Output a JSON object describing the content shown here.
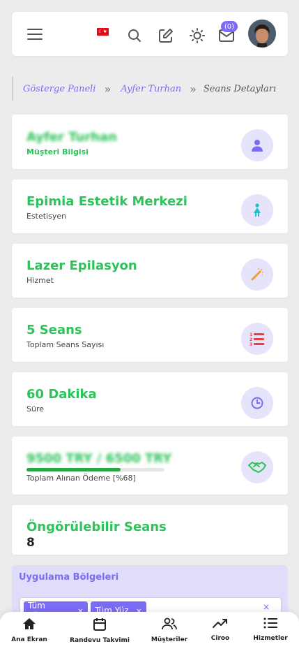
{
  "header": {
    "menu_icon": "hamburger-icon",
    "flag_icon": "turkey-flag-icon",
    "flag_glyph": "☾★",
    "icons": [
      "search-icon",
      "edit-icon",
      "sun-icon",
      "mail-icon"
    ],
    "mail_badge": "(0)",
    "avatar": "user-avatar"
  },
  "breadcrumb": {
    "items": [
      "Gösterge Paneli",
      "Ayfer Turhan",
      "Seans Detayları"
    ],
    "separator": "»"
  },
  "cards": [
    {
      "title": "Ayfer Turhan",
      "subtitle": "Müşteri Bilgisi",
      "icon": "user-icon"
    },
    {
      "title": "Epimia Estetik Merkezi",
      "subtitle": "Estetisyen",
      "icon": "female-person-icon"
    },
    {
      "title": "Lazer Epilasyon",
      "subtitle": "Hizmet",
      "icon": "magic-wand-icon"
    },
    {
      "title": "5 Seans",
      "subtitle": "Toplam Seans Sayısı",
      "icon": "numbered-list-icon"
    },
    {
      "title": "60 Dakika",
      "subtitle": "Süre",
      "icon": "clock-icon"
    },
    {
      "title": "9500 TRY / 6500 TRY",
      "subtitle": "Toplam Alınan Ödeme [%68]",
      "icon": "handshake-icon",
      "progress_percent": 68
    },
    {
      "title": "Öngörülebilir Seans",
      "value": "8"
    }
  ],
  "application_areas": {
    "title": "Uygulama Bölgeleri",
    "tags": [
      "Tüm Vücut",
      "Tüm Yüz"
    ],
    "tag_remove": "×",
    "clear": "×"
  },
  "bottom_nav": [
    {
      "label": "Ana Ekran",
      "icon": "home-icon"
    },
    {
      "label": "Randevu Takvimi",
      "icon": "calendar-icon"
    },
    {
      "label": "Müşteriler",
      "icon": "users-icon"
    },
    {
      "label": "Ciroo",
      "icon": "trending-up-icon"
    },
    {
      "label": "Hizmetler",
      "icon": "list-icon"
    }
  ],
  "colors": {
    "accent": "#7b6cf6",
    "title_green": "#2ec25a",
    "progress_green": "#28a745",
    "icon_circle_bg": "#e6e4fb",
    "flag_red": "#e30a17"
  }
}
